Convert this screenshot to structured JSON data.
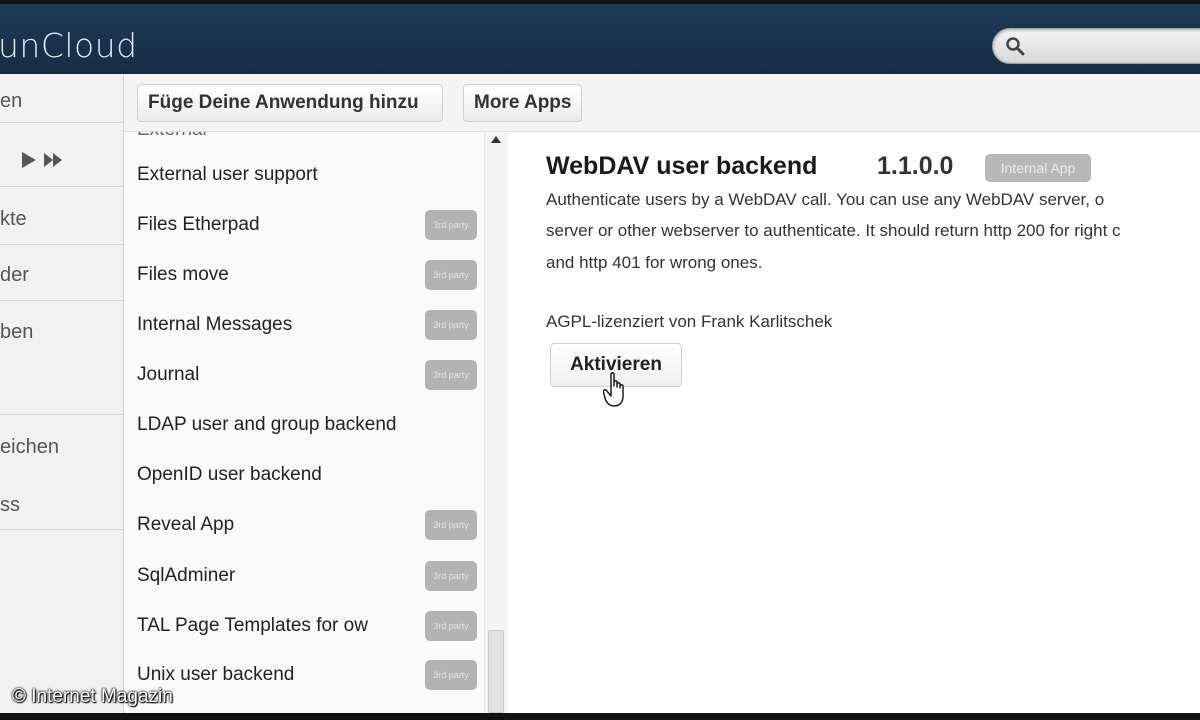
{
  "header": {
    "logo_text": "unCloud",
    "search": {
      "placeholder": ""
    },
    "colors": {
      "background": "#1e3a56",
      "logo": "#dfe8f1"
    }
  },
  "left_nav": {
    "items": [
      {
        "label": "en"
      },
      {
        "label": "kte"
      },
      {
        "label": "der"
      },
      {
        "label": "ben"
      },
      {
        "label": "eichen"
      },
      {
        "label": "ss"
      }
    ],
    "media_icons": [
      "play-icon",
      "fast-forward-icon"
    ]
  },
  "toolbar": {
    "add_app_label": "Füge Deine Anwendung hinzu",
    "more_apps_label": "More Apps"
  },
  "app_list": {
    "cut_item": "External",
    "items": [
      {
        "name": "External user support",
        "badge": ""
      },
      {
        "name": "Files Etherpad",
        "badge": "3rd party"
      },
      {
        "name": "Files move",
        "badge": "3rd party"
      },
      {
        "name": "Internal Messages",
        "badge": "3rd party"
      },
      {
        "name": "Journal",
        "badge": "3rd party"
      },
      {
        "name": "LDAP user and group backend",
        "badge": ""
      },
      {
        "name": "OpenID user backend",
        "badge": ""
      },
      {
        "name": "Reveal App",
        "badge": "3rd party"
      },
      {
        "name": "SqlAdminer",
        "badge": "3rd party"
      },
      {
        "name": "TAL Page Templates for ow",
        "badge": "3rd party"
      },
      {
        "name": "Unix user backend",
        "badge": "3rd party"
      }
    ]
  },
  "detail": {
    "title": "WebDAV user backend",
    "version": "1.1.0.0",
    "badge": "Internal App",
    "description_lines": [
      "Authenticate users by a WebDAV call. You can use any WebDAV server, o",
      "server or other webserver to authenticate. It should return http 200 for right c",
      "and http 401 for wrong ones."
    ],
    "license": "AGPL-lizenziert von Frank Karlitschek",
    "activate_label": "Aktivieren"
  },
  "watermark": "© Internet Magazin"
}
